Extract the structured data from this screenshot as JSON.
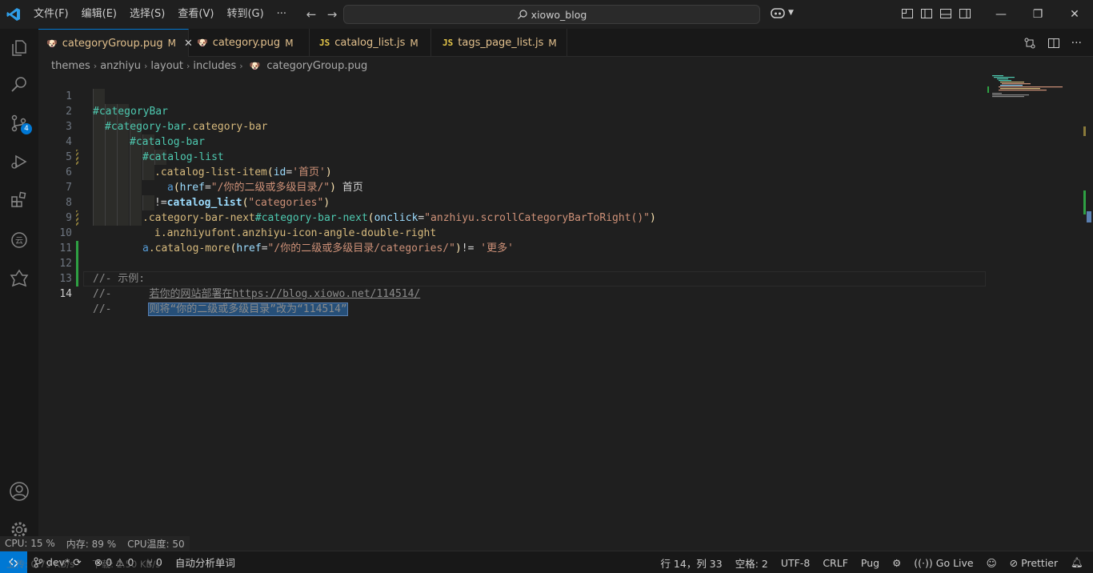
{
  "window": {
    "title": "xiowo_blog"
  },
  "menu": [
    "文件(F)",
    "编辑(E)",
    "选择(S)",
    "查看(V)",
    "转到(G)",
    "···"
  ],
  "tabs": [
    {
      "label": "categoryGroup.pug",
      "status": "M",
      "type": "pug"
    },
    {
      "label": "category.pug",
      "status": "M",
      "type": "pug"
    },
    {
      "label": "catalog_list.js",
      "status": "M",
      "type": "js",
      "prefix": "JS"
    },
    {
      "label": "tags_page_list.js",
      "status": "M",
      "type": "js",
      "prefix": "JS"
    }
  ],
  "breadcrumb": [
    "themes",
    "anzhiyu",
    "layout",
    "includes",
    "categoryGroup.pug"
  ],
  "activity": {
    "scm_badge": "4"
  },
  "editor": {
    "line_numbers": [
      "1",
      "2",
      "3",
      "4",
      "5",
      "6",
      "7",
      "8",
      "9",
      "10",
      "11",
      "12",
      "13",
      "14"
    ],
    "l1": "#categoryBar",
    "l2a": "#category-bar",
    "l2b": ".category-bar",
    "l3": "#catalog-bar",
    "l4": "#catalog-list",
    "l5a": ".catalog-list-item",
    "l5b": "(",
    "l5c": "id",
    "l5d": "=",
    "l5e": "'首页'",
    "l5f": ")",
    "l6a": "a",
    "l6b": "(",
    "l6c": "href",
    "l6d": "=",
    "l6e": "\"/你的二级或多级目录/\"",
    "l6f": ")",
    "l6g": " 首页",
    "l7a": "!=",
    "l7b": "catalog_list",
    "l7c": "(",
    "l7d": "\"categories\"",
    "l7e": ")",
    "l8a": ".category-bar-next",
    "l8b": "#category-bar-next",
    "l8c": "(",
    "l8d": "onclick",
    "l8e": "=",
    "l8f": "\"anzhiyu.scrollCategoryBarToRight()\"",
    "l8g": ")",
    "l9": "i.anzhiyufont.anzhiyu-icon-angle-double-right",
    "l10a": "a",
    "l10b": ".catalog-more",
    "l10c": "(",
    "l10d": "href",
    "l10e": "=",
    "l10f": "\"/你的二级或多级目录/categories/\"",
    "l10g": ")",
    "l10h": "!= ",
    "l10i": "'更多'",
    "l12": "//- 示例:",
    "l13a": "//-      ",
    "l13b": "若你的网站部署在https://blog.xiowo.net/114514/",
    "l14a": "//-      ",
    "l14b": "则将“你的二级或多级目录”改为“114514”"
  },
  "perf": {
    "cpu": "CPU: 15 %",
    "mem": "内存: 89 %",
    "temp": "CPU温度: 50"
  },
  "net": {
    "up": "上传: 0.79 KB/s",
    "down": "下载: 2.50 KB/s"
  },
  "status": {
    "branch": "dev*",
    "errors": "0",
    "warnings": "0",
    "ports": "0",
    "spell": "自动分析单词",
    "position": "行 14，列 33",
    "spaces": "空格: 2",
    "encoding": "UTF-8",
    "eol": "CRLF",
    "language": "Pug",
    "golive": "Go Live",
    "prettier": "Prettier"
  },
  "colors": {
    "accent": "#0078d4",
    "modified": "#e2c08d"
  }
}
